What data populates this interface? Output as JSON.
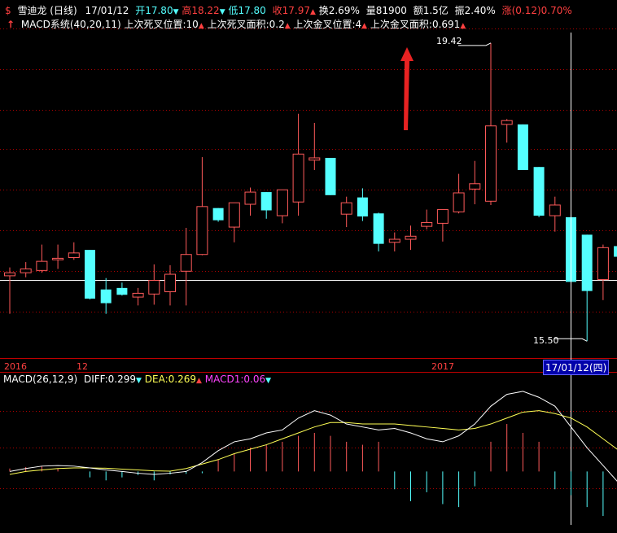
{
  "header": {
    "flag": "$",
    "name": "雪迪龙 (日线)",
    "date": "17/01/12",
    "open": "开17.80",
    "open_arrow": "▼",
    "high": "高18.22",
    "high_arrow": "▼",
    "low": "低17.80",
    "close": "收17.97",
    "close_arrow": "▲",
    "turnover": "换2.69%",
    "volume": "量81900",
    "amount": "额1.5亿",
    "amplitude": "振2.40%",
    "change": "涨(0.12)0.70%"
  },
  "subheader": {
    "marker": "↑",
    "indicator": "MACD系统(40,20,11)",
    "dead_pos": "上次死叉位置:10",
    "dead_area": "上次死叉面积:0.2",
    "gold_pos": "上次金叉位置:4",
    "gold_area": "上次金叉面积:0.691"
  },
  "macd_header": {
    "name": "MACD(26,12,9)",
    "diff": "DIFF:0.299",
    "diff_arrow": "▼",
    "dea": "DEA:0.269",
    "dea_arrow": "▲",
    "macd1": "MACD1:0.06",
    "macd1_arrow": "▼"
  },
  "colors": {
    "up": "#ff5a5a",
    "down": "#54ffff",
    "bg": "#000000",
    "grid": "#b00000",
    "diff": "#ffffff",
    "dea": "#ffff55"
  },
  "chart_data": [
    {
      "type": "candlestick",
      "title": "雪迪龙 (日线)",
      "high_label": "19.42",
      "low_label": "15.50",
      "axis_labels": [
        "2016",
        "12",
        "2017"
      ],
      "cursor_label": "17/01/12(四)",
      "candles": [
        {
          "o": 16.36,
          "h": 16.47,
          "l": 15.86,
          "c": 16.4
        },
        {
          "o": 16.4,
          "h": 16.54,
          "l": 16.34,
          "c": 16.45
        },
        {
          "o": 16.43,
          "h": 16.77,
          "l": 16.4,
          "c": 16.55
        },
        {
          "o": 16.57,
          "h": 16.77,
          "l": 16.45,
          "c": 16.59
        },
        {
          "o": 16.6,
          "h": 16.8,
          "l": 16.57,
          "c": 16.66
        },
        {
          "o": 16.7,
          "h": 16.7,
          "l": 16.05,
          "c": 16.06
        },
        {
          "o": 16.18,
          "h": 16.33,
          "l": 15.86,
          "c": 16.0
        },
        {
          "o": 16.2,
          "h": 16.27,
          "l": 16.1,
          "c": 16.11
        },
        {
          "o": 16.08,
          "h": 16.2,
          "l": 15.97,
          "c": 16.13
        },
        {
          "o": 16.12,
          "h": 16.51,
          "l": 15.98,
          "c": 16.3
        },
        {
          "o": 16.15,
          "h": 16.5,
          "l": 15.97,
          "c": 16.38
        },
        {
          "o": 16.42,
          "h": 16.99,
          "l": 15.97,
          "c": 16.64
        },
        {
          "o": 16.64,
          "h": 17.92,
          "l": 16.63,
          "c": 17.27
        },
        {
          "o": 17.25,
          "h": 17.25,
          "l": 17.07,
          "c": 17.09
        },
        {
          "o": 17.0,
          "h": 17.31,
          "l": 16.8,
          "c": 17.32
        },
        {
          "o": 17.3,
          "h": 17.52,
          "l": 17.15,
          "c": 17.46
        },
        {
          "o": 17.46,
          "h": 17.46,
          "l": 17.11,
          "c": 17.22
        },
        {
          "o": 17.15,
          "h": 17.49,
          "l": 17.05,
          "c": 17.49
        },
        {
          "o": 17.33,
          "h": 18.49,
          "l": 17.15,
          "c": 17.96
        },
        {
          "o": 17.88,
          "h": 18.37,
          "l": 17.75,
          "c": 17.91
        },
        {
          "o": 17.91,
          "h": 17.91,
          "l": 17.42,
          "c": 17.42
        },
        {
          "o": 17.17,
          "h": 17.4,
          "l": 17.0,
          "c": 17.32
        },
        {
          "o": 17.39,
          "h": 17.51,
          "l": 17.08,
          "c": 17.14
        },
        {
          "o": 17.18,
          "h": 17.19,
          "l": 16.68,
          "c": 16.78
        },
        {
          "o": 16.8,
          "h": 16.93,
          "l": 16.68,
          "c": 16.84
        },
        {
          "o": 16.84,
          "h": 17.02,
          "l": 16.7,
          "c": 16.88
        },
        {
          "o": 17.01,
          "h": 17.23,
          "l": 16.97,
          "c": 17.06
        },
        {
          "o": 17.05,
          "h": 17.21,
          "l": 16.81,
          "c": 17.23
        },
        {
          "o": 17.2,
          "h": 17.7,
          "l": 17.18,
          "c": 17.45
        },
        {
          "o": 17.5,
          "h": 17.87,
          "l": 17.3,
          "c": 17.57
        },
        {
          "o": 17.34,
          "h": 19.42,
          "l": 17.29,
          "c": 18.33
        },
        {
          "o": 18.35,
          "h": 18.42,
          "l": 18.11,
          "c": 18.4
        },
        {
          "o": 18.35,
          "h": 18.35,
          "l": 17.75,
          "c": 17.75
        },
        {
          "o": 17.79,
          "h": 17.79,
          "l": 17.13,
          "c": 17.15
        },
        {
          "o": 17.15,
          "h": 17.4,
          "l": 16.94,
          "c": 17.29
        },
        {
          "o": 17.13,
          "h": 17.13,
          "l": 16.28,
          "c": 16.28
        },
        {
          "o": 16.9,
          "h": 16.9,
          "l": 15.5,
          "c": 16.16
        },
        {
          "o": 16.31,
          "h": 16.77,
          "l": 16.04,
          "c": 16.73
        },
        {
          "o": 16.75,
          "h": 16.91,
          "l": 16.56,
          "c": 16.61
        }
      ]
    },
    {
      "type": "line",
      "title": "MACD(26,12,9)",
      "series": [
        {
          "name": "DIFF",
          "values": [
            0.0,
            0.01,
            0.018,
            0.02,
            0.018,
            0.012,
            0.005,
            0.0,
            -0.006,
            -0.01,
            -0.006,
            0.0,
            0.03,
            0.07,
            0.1,
            0.11,
            0.13,
            0.14,
            0.18,
            0.205,
            0.19,
            0.16,
            0.15,
            0.14,
            0.145,
            0.13,
            0.11,
            0.1,
            0.12,
            0.16,
            0.22,
            0.26,
            0.27,
            0.25,
            0.22,
            0.15,
            0.08,
            0.02,
            -0.04
          ]
        },
        {
          "name": "DEA",
          "values": [
            -0.01,
            0.0,
            0.005,
            0.01,
            0.012,
            0.012,
            0.011,
            0.008,
            0.005,
            0.002,
            0.001,
            0.01,
            0.025,
            0.04,
            0.06,
            0.075,
            0.09,
            0.11,
            0.13,
            0.15,
            0.165,
            0.165,
            0.16,
            0.16,
            0.16,
            0.155,
            0.15,
            0.145,
            0.14,
            0.145,
            0.16,
            0.18,
            0.2,
            0.205,
            0.195,
            0.18,
            0.15,
            0.11,
            0.07
          ]
        },
        {
          "name": "MACD1",
          "values": [
            0.01,
            0.015,
            0.018,
            0.01,
            0.0,
            -0.02,
            -0.03,
            -0.02,
            -0.012,
            -0.03,
            -0.01,
            -0.008,
            -0.006,
            0.04,
            0.06,
            0.08,
            0.09,
            0.1,
            0.12,
            0.13,
            0.12,
            0.1,
            0.09,
            0.1,
            -0.06,
            -0.1,
            -0.07,
            -0.11,
            -0.12,
            -0.05,
            0.1,
            0.16,
            0.13,
            0.1,
            -0.06,
            -0.08,
            -0.12,
            -0.15,
            -0.17
          ]
        }
      ]
    }
  ]
}
